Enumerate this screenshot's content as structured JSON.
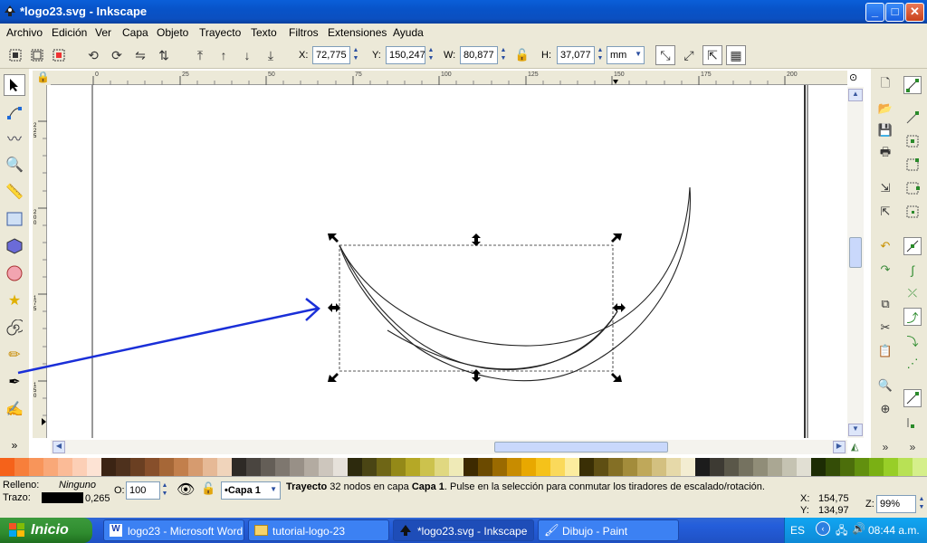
{
  "window": {
    "title": "*logo23.svg - Inkscape",
    "min": "_",
    "max": "□",
    "close": "✕"
  },
  "menus": [
    "Archivo",
    "Edición",
    "Ver",
    "Capa",
    "Objeto",
    "Trayecto",
    "Texto",
    "Filtros",
    "Extensiones",
    "Ayuda"
  ],
  "controls": {
    "x_label": "X:",
    "x_value": "72,775",
    "y_label": "Y:",
    "y_value": "150,247",
    "w_label": "W:",
    "w_value": "80,877",
    "h_label": "H:",
    "h_value": "37,077",
    "unit": "mm"
  },
  "ruler": {
    "h_ticks": [
      "0",
      "25",
      "50",
      "75",
      "100",
      "125",
      "150",
      "175",
      "200"
    ],
    "v_ticks": [
      "2\n2\n5",
      "2\n0\n0",
      "1\n7\n5",
      "1\n5\n0"
    ]
  },
  "palette": [
    "#f5621a",
    "#f77f3b",
    "#f8955a",
    "#f9a878",
    "#fbbb97",
    "#fccfb6",
    "#fde3d4",
    "#3b2414",
    "#4e311d",
    "#6a3f22",
    "#874f2b",
    "#a66737",
    "#c27f4c",
    "#d69b6f",
    "#e6b996",
    "#f0d4bb",
    "#2e2a26",
    "#4a4540",
    "#645e57",
    "#7e776f",
    "#989087",
    "#b3aba1",
    "#cdc6bd",
    "#e6e1da",
    "#2d2a0d",
    "#4a4514",
    "#6f6616",
    "#948918",
    "#b5a826",
    "#ccc24d",
    "#e0d881",
    "#efeab7",
    "#3d2a00",
    "#6b4a00",
    "#9a6a00",
    "#c88c00",
    "#e8a800",
    "#f5c21a",
    "#fad95b",
    "#fcec9e",
    "#3a2f05",
    "#5f4f13",
    "#846f25",
    "#a38c3b",
    "#bfa85a",
    "#d3c080",
    "#e6d9a9",
    "#f3edd2",
    "#1c1c1c",
    "#3d3a33",
    "#5a5749",
    "#757260",
    "#908d78",
    "#aaa793",
    "#c5c3b2",
    "#e1dfd3",
    "#1d2c04",
    "#344d07",
    "#4c6e0b",
    "#62900f",
    "#7ab014",
    "#98ce28",
    "#b8e155",
    "#d5ef8b"
  ],
  "status": {
    "fill_label": "Relleno:",
    "fill_value": "Ninguno",
    "stroke_label": "Trazo:",
    "stroke_width": "0,265",
    "opacity_label": "O:",
    "opacity_value": "100",
    "layer": "•Capa 1",
    "msg_bold1": "Trayecto",
    "msg1": " 32 nodos en capa ",
    "msg_bold2": "Capa 1",
    "msg2": ". Pulse en la selección para conmutar los tiradores de escalado/rotación.",
    "cx_label": "X:",
    "cx": "154,75",
    "cy_label": "Y:",
    "cy": "134,97",
    "zoom_label": "Z:",
    "zoom": "99%"
  },
  "taskbar": {
    "start": "Inicio",
    "tasks": [
      "logo23 - Microsoft Word",
      "tutorial-logo-23",
      "*logo23.svg - Inkscape",
      "Dibujo - Paint"
    ],
    "lang": "ES",
    "time": "08:44 a.m."
  }
}
